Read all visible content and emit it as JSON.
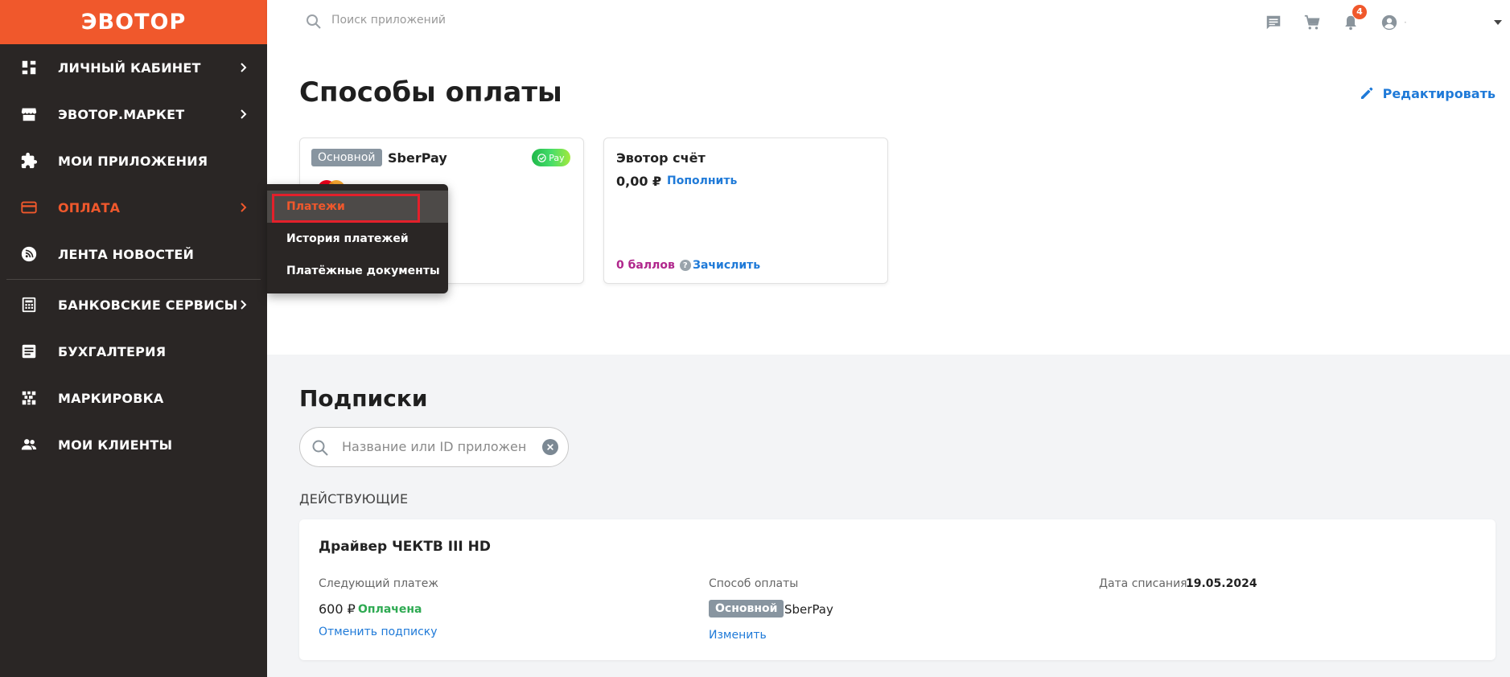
{
  "app": {
    "logo": "ЭВОТОР",
    "accent": "#f0582c"
  },
  "sidebar": {
    "items": [
      {
        "label": "ЛИЧНЫЙ КАБИНЕТ",
        "icon": "dashboard-icon",
        "chevron": true
      },
      {
        "label": "ЭВОТОР.МАРКЕТ",
        "icon": "store-icon",
        "chevron": true
      },
      {
        "label": "МОИ ПРИЛОЖЕНИЯ",
        "icon": "puzzle-icon",
        "chevron": false
      },
      {
        "label": "ОПЛАТА",
        "icon": "credit-card-icon",
        "chevron": true,
        "active": true
      },
      {
        "label": "ЛЕНТА НОВОСТЕЙ",
        "icon": "rss-icon",
        "chevron": false
      },
      {
        "label": "БАНКОВСКИЕ СЕРВИСЫ",
        "icon": "bank-icon",
        "chevron": true
      },
      {
        "label": "БУХГАЛТЕРИЯ",
        "icon": "ledger-icon",
        "chevron": false
      },
      {
        "label": "МАРКИРОВКА",
        "icon": "qr-code-icon",
        "chevron": false
      },
      {
        "label": "МОИ КЛИЕНТЫ",
        "icon": "people-icon",
        "chevron": false
      }
    ]
  },
  "flyout": {
    "items": [
      {
        "label": "Платежи",
        "active": true
      },
      {
        "label": "История платежей"
      },
      {
        "label": "Платёжные документы"
      }
    ]
  },
  "topbar": {
    "search_placeholder": "Поиск приложений",
    "notification_count": "4",
    "user_name": "·"
  },
  "payment_methods": {
    "title": "Способы оплаты",
    "edit_label": "Редактировать",
    "card1": {
      "tag": "Основной",
      "name": "SberPay",
      "badge": "Pay"
    },
    "card2": {
      "title": "Эвотор счёт",
      "balance": "0,00 ₽",
      "topup_label": "Пополнить",
      "bonus": "0 баллов",
      "credit_label": "Зачислить"
    }
  },
  "subscriptions": {
    "title": "Подписки",
    "search_placeholder": "Название или ID приложения",
    "active_label": "ДЕЙСТВУЮЩИЕ",
    "items": [
      {
        "name": "Драйвер ЧЕКТВ III HD",
        "next_payment_label": "Следующий платеж",
        "amount": "600 ₽",
        "status": "Оплачена",
        "cancel_label": "Отменить подписку",
        "method_label": "Способ оплаты",
        "method_tag": "Основной",
        "method_name": "SberPay",
        "change_label": "Изменить",
        "debit_label": "Дата списания",
        "debit_date": "19.05.2024"
      }
    ]
  }
}
